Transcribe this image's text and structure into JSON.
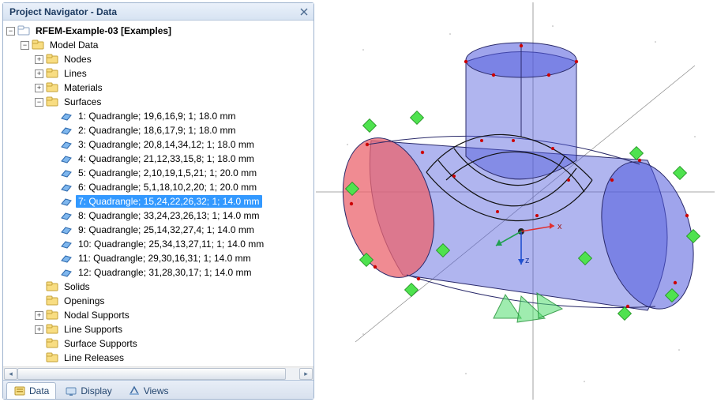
{
  "panel": {
    "title": "Project Navigator - Data"
  },
  "tree": {
    "root": {
      "label": "RFEM-Example-03 [Examples]"
    },
    "modelData": {
      "label": "Model Data"
    },
    "nodes": {
      "label": "Nodes"
    },
    "lines": {
      "label": "Lines"
    },
    "materials": {
      "label": "Materials"
    },
    "surfaces": {
      "label": "Surfaces"
    },
    "solids": {
      "label": "Solids"
    },
    "openings": {
      "label": "Openings"
    },
    "nodalSupports": {
      "label": "Nodal Supports"
    },
    "lineSupports": {
      "label": "Line Supports"
    },
    "surfaceSupports": {
      "label": "Surface Supports"
    },
    "lineReleases": {
      "label": "Line Releases"
    },
    "surfaceItems": [
      {
        "label": "1: Quadrangle; 19,6,16,9; 1; 18.0 mm"
      },
      {
        "label": "2: Quadrangle; 18,6,17,9; 1; 18.0 mm"
      },
      {
        "label": "3: Quadrangle; 20,8,14,34,12; 1; 18.0 mm"
      },
      {
        "label": "4: Quadrangle; 21,12,33,15,8; 1; 18.0 mm"
      },
      {
        "label": "5: Quadrangle; 2,10,19,1,5,21; 1; 20.0 mm"
      },
      {
        "label": "6: Quadrangle; 5,1,18,10,2,20; 1; 20.0 mm"
      },
      {
        "label": "7: Quadrangle; 15,24,22,26,32; 1; 14.0 mm"
      },
      {
        "label": "8: Quadrangle; 33,24,23,26,13; 1; 14.0 mm"
      },
      {
        "label": "9: Quadrangle; 25,14,32,27,4; 1; 14.0 mm"
      },
      {
        "label": "10: Quadrangle; 25,34,13,27,11; 1; 14.0 mm"
      },
      {
        "label": "11: Quadrangle; 29,30,16,31; 1; 14.0 mm"
      },
      {
        "label": "12: Quadrangle; 31,28,30,17; 1; 14.0 mm"
      }
    ],
    "selectedSurfaceIndex": 6
  },
  "tabs": {
    "data": "Data",
    "display": "Display",
    "views": "Views"
  },
  "axes": {
    "x": "x",
    "z": "z"
  }
}
